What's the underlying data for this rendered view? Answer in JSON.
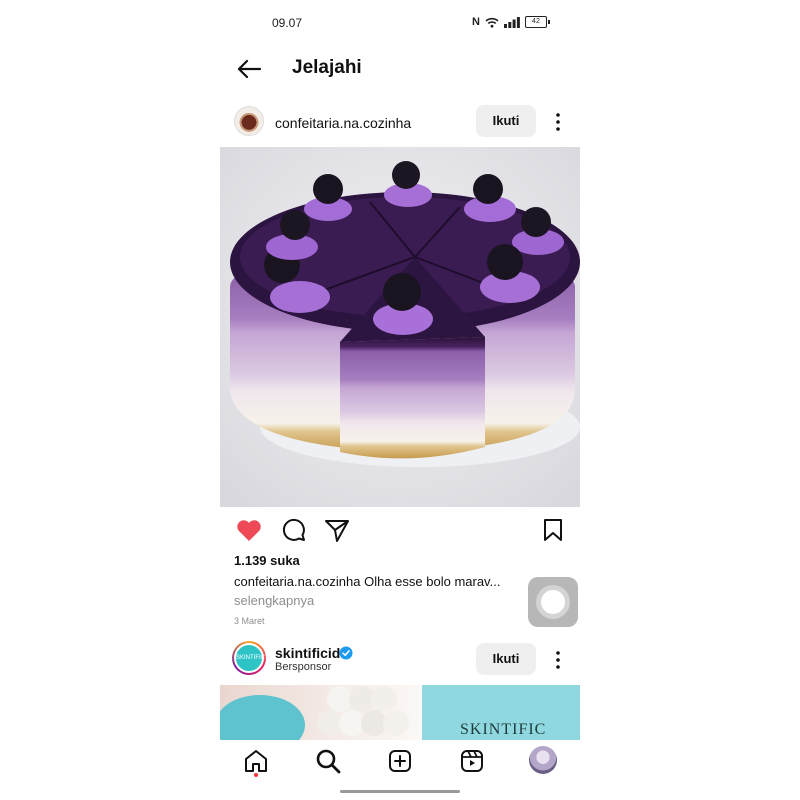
{
  "status_bar": {
    "time": "09.07",
    "nfc": "N",
    "battery": "42"
  },
  "header": {
    "title": "Jelajahi"
  },
  "post1": {
    "username": "confeitaria.na.cozinha",
    "follow_label": "Ikuti",
    "image_alt": "layered purple mousse cake with blackberries",
    "likes": "1.139 suka",
    "caption_user": "confeitaria.na.cozinha",
    "caption_text": "Olha esse bolo marav...",
    "more_label": "selengkapnya",
    "date": "3 Maret"
  },
  "post2": {
    "username": "skintificid",
    "sponsored": "Bersponsor",
    "follow_label": "Ikuti",
    "avatar_text": "SKINTIFIC",
    "ad_brand": "SKINTIFIC"
  },
  "colors": {
    "like_red": "#ed4956",
    "verified_blue": "#1d9bf0",
    "follow_bg": "#efefef"
  },
  "icons": {
    "back": "arrow-left-icon",
    "more": "more-vertical-icon",
    "like": "heart-filled-icon",
    "comment": "comment-icon",
    "share": "paper-plane-icon",
    "save": "bookmark-icon",
    "verified": "verified-badge-icon",
    "home": "home-icon",
    "search": "search-icon",
    "add": "plus-square-icon",
    "reels": "reels-icon",
    "profile": "profile-avatar"
  }
}
